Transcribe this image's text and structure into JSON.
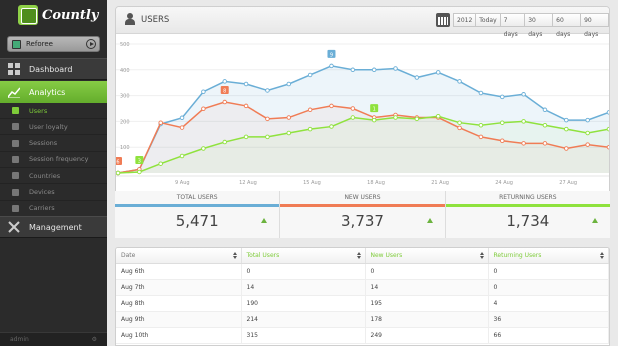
{
  "app": {
    "brand": "Countly",
    "selected_app": "Reforee",
    "user": "admin"
  },
  "sidebar": {
    "dashboard": "Dashboard",
    "analytics": "Analytics",
    "management": "Management",
    "items": [
      {
        "label": "Users",
        "icon": "user-icon",
        "active": true
      },
      {
        "label": "User loyalty",
        "icon": "heart-icon"
      },
      {
        "label": "Sessions",
        "icon": "session-icon"
      },
      {
        "label": "Session frequency",
        "icon": "bars-icon"
      },
      {
        "label": "Countries",
        "icon": "map-pin-icon"
      },
      {
        "label": "Devices",
        "icon": "device-icon"
      },
      {
        "label": "Carriers",
        "icon": "signal-icon"
      }
    ]
  },
  "header": {
    "title": "USERS",
    "ranges": [
      "2012",
      "Today",
      "7 days",
      "30 days",
      "60 days",
      "90 days"
    ]
  },
  "chart_data": {
    "type": "line",
    "y_ticks": [
      "500",
      "400",
      "300",
      "200",
      "100"
    ],
    "ylim": [
      0,
      500
    ],
    "x_tick_labels": [
      "9 Aug",
      "12 Aug",
      "15 Aug",
      "18 Aug",
      "21 Aug",
      "24 Aug",
      "27 Aug"
    ],
    "x_tick_index": [
      3,
      6,
      9,
      12,
      15,
      18,
      21
    ],
    "points_count": 24,
    "markers": [
      {
        "series": 1,
        "label": "6"
      },
      {
        "series": 1,
        "label": "8"
      },
      {
        "series": 0,
        "label": "9"
      },
      {
        "series": 2,
        "label": "1"
      },
      {
        "series": 2,
        "label": "3"
      }
    ],
    "marker_index": [
      0,
      5,
      10,
      12,
      1
    ],
    "series": [
      {
        "color": "#6aaed6",
        "values": [
          0,
          14,
          190,
          214,
          315,
          355,
          345,
          320,
          345,
          380,
          415,
          400,
          400,
          405,
          370,
          390,
          355,
          310,
          295,
          305,
          245,
          205,
          205,
          235
        ]
      },
      {
        "color": "#f07c55",
        "values": [
          0,
          14,
          195,
          176,
          249,
          275,
          260,
          210,
          215,
          245,
          260,
          250,
          215,
          225,
          215,
          215,
          175,
          140,
          125,
          115,
          115,
          95,
          110,
          100
        ]
      },
      {
        "color": "#8fe23d",
        "values": [
          0,
          4,
          36,
          66,
          95,
          120,
          140,
          140,
          155,
          170,
          180,
          215,
          205,
          215,
          210,
          220,
          195,
          185,
          195,
          200,
          185,
          170,
          155,
          170
        ]
      }
    ]
  },
  "totals": [
    {
      "label": "TOTAL USERS",
      "value": "5,471",
      "color": "#6aaed6"
    },
    {
      "label": "NEW USERS",
      "value": "3,737",
      "color": "#f07c55"
    },
    {
      "label": "RETURNING USERS",
      "value": "1,734",
      "color": "#8fe23d"
    }
  ],
  "table": {
    "headers": [
      "Date",
      "Total Users",
      "New Users",
      "Returning Users"
    ],
    "rows": [
      [
        "Aug 6th",
        "0",
        "0",
        "0"
      ],
      [
        "Aug 7th",
        "14",
        "14",
        "0"
      ],
      [
        "Aug 8th",
        "190",
        "195",
        "4"
      ],
      [
        "Aug 9th",
        "214",
        "178",
        "36"
      ],
      [
        "Aug 10th",
        "315",
        "249",
        "66"
      ]
    ]
  }
}
